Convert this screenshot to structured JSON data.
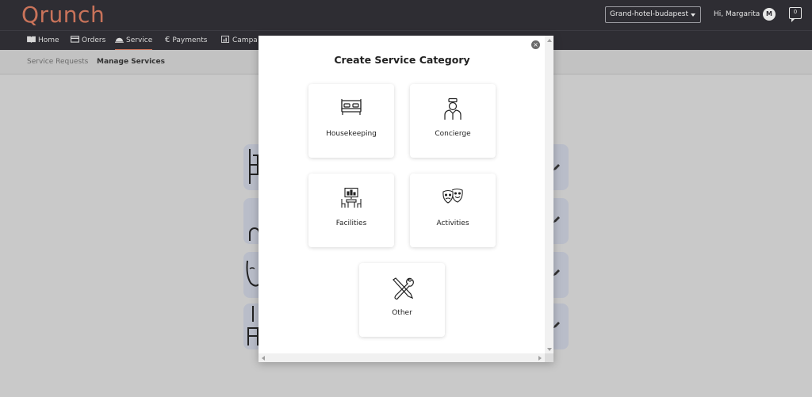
{
  "app": {
    "logo": "Qrunch"
  },
  "header": {
    "hotel_select": "Grand-hotel-budapest",
    "greeting": "Hi, Margarita",
    "avatar_initial": "M",
    "chat_count": "0"
  },
  "nav": {
    "items": [
      {
        "label": "Home"
      },
      {
        "label": "Orders"
      },
      {
        "label": "Service"
      },
      {
        "label": "Payments"
      },
      {
        "label": "Campa"
      }
    ]
  },
  "subnav": {
    "tabs": [
      {
        "label": "Service Requests"
      },
      {
        "label": "Manage Services"
      }
    ]
  },
  "modal": {
    "title": "Create Service Category",
    "close": "×",
    "categories": [
      {
        "label": "Housekeeping",
        "icon": "bed-icon"
      },
      {
        "label": "Concierge",
        "icon": "bellhop-icon"
      },
      {
        "label": "Facilities",
        "icon": "conference-room-icon"
      },
      {
        "label": "Activities",
        "icon": "theater-masks-icon"
      },
      {
        "label": "Other",
        "icon": "tools-icon"
      }
    ]
  },
  "colors": {
    "brand": "#c9735a",
    "topbar": "#2e2d33",
    "overlay": "#c9c9c9",
    "card_bg": "#b9bdc9"
  }
}
